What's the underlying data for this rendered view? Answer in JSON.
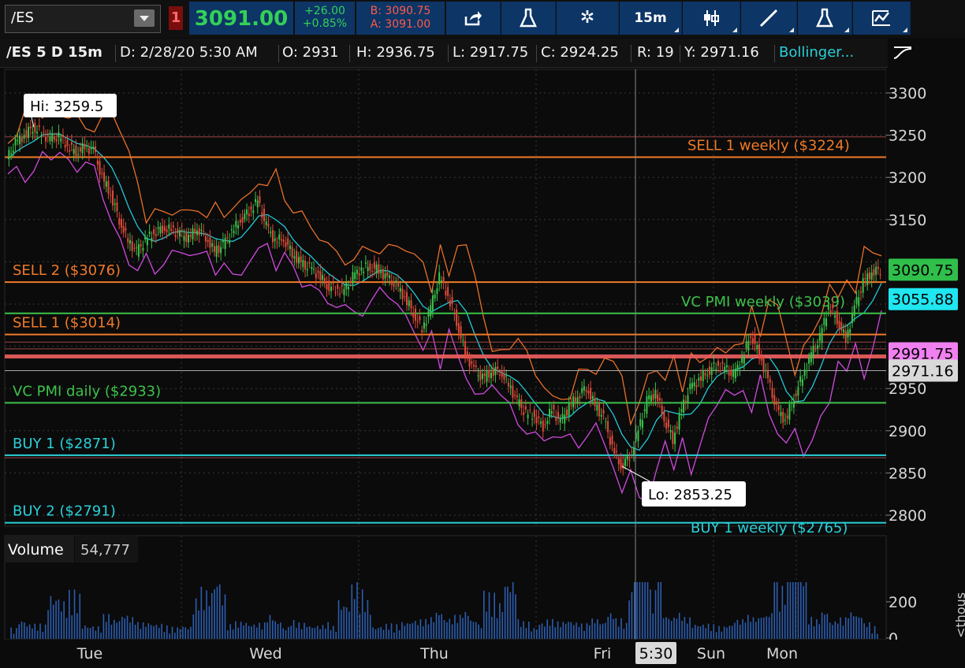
{
  "toolbar": {
    "symbol": "/ES",
    "link_number": "1",
    "last_price": "3091.00",
    "net_change": "+26.00",
    "percent_change": "+0.85%",
    "bid": "B: 3090.75",
    "ask": "A: 3091.00",
    "timeframe": "15m",
    "icons": [
      "share-icon",
      "flask-icon",
      "gear-icon",
      "candlestick-icon",
      "line-draw-icon",
      "flask-icon",
      "pattern-icon"
    ]
  },
  "info_bar": {
    "symbol_period": "/ES 5 D 15m",
    "date": "D: 2/28/20 5:30 AM",
    "open": "O: 2931",
    "high": "H: 2936.75",
    "low": "L: 2917.75",
    "close": "C: 2924.25",
    "range": "R: 19",
    "y": "Y: 2971.16",
    "study": "Bollinger..."
  },
  "chart_data": {
    "type": "line",
    "symbol": "/ES",
    "period": "5 D 15m",
    "x_labels": [
      "Tue",
      "Wed",
      "Thu",
      "Fri",
      "Sun",
      "Mon"
    ],
    "cursor_time_label": "5:30",
    "y_ticks": [
      3300,
      3250,
      3200,
      3150,
      2950,
      2900,
      2850,
      2800
    ],
    "ylim": [
      2790,
      3310
    ],
    "grid": true,
    "annotations": {
      "high": "Hi: 3259.5",
      "low": "Lo: 2853.25"
    },
    "levels": [
      {
        "label": "SELL 1 weekly ($3224)",
        "value": 3224,
        "color": "#f07a28"
      },
      {
        "label": "SELL 2  ($3076)",
        "value": 3076,
        "color": "#f07a28"
      },
      {
        "label": "VC PMI weekly ($3039)",
        "value": 3039,
        "color": "#3cc24a"
      },
      {
        "label": "SELL 1 ($3014)",
        "value": 3014,
        "color": "#f07a28"
      },
      {
        "label": "VC PMI daily ($2933)",
        "value": 2933,
        "color": "#3cc24a"
      },
      {
        "label": "BUY 1  ($2871)",
        "value": 2871,
        "color": "#2ad0d8"
      },
      {
        "label": "BUY 2  ($2791)",
        "value": 2791,
        "color": "#2ad0d8"
      },
      {
        "label": "BUY 1 weekly ($2765)",
        "value": 2765,
        "color": "#2ad0d8"
      }
    ],
    "price_badges": [
      {
        "label": "3090.75",
        "value": 3090.75,
        "bg": "#2fbf4a",
        "fg": "#000000"
      },
      {
        "label": "3055.88",
        "value": 3055.88,
        "bg": "#20e6f0",
        "fg": "#000000"
      },
      {
        "label": "2991.75",
        "value": 2991.75,
        "bg": "#f080f0",
        "fg": "#000000"
      },
      {
        "label": "2971.16",
        "value": 2971.16,
        "bg": "#d9d9d9",
        "fg": "#000000"
      }
    ],
    "price_series": [
      3222,
      3240,
      3250,
      3259.5,
      3252,
      3245,
      3248,
      3238,
      3230,
      3236,
      3232,
      3200,
      3180,
      3150,
      3125,
      3112,
      3125,
      3135,
      3140,
      3138,
      3132,
      3128,
      3140,
      3130,
      3112,
      3120,
      3135,
      3150,
      3160,
      3172,
      3142,
      3125,
      3128,
      3110,
      3098,
      3092,
      3085,
      3072,
      3068,
      3066,
      3082,
      3092,
      3095,
      3090,
      3080,
      3072,
      3058,
      3040,
      3020,
      3045,
      3082,
      3060,
      3030,
      2992,
      2972,
      2962,
      2970,
      2972,
      2955,
      2935,
      2920,
      2918,
      2905,
      2925,
      2910,
      2928,
      2942,
      2952,
      2930,
      2915,
      2880,
      2858,
      2870,
      2900,
      2935,
      2945,
      2915,
      2890,
      2925,
      2950,
      2960,
      2970,
      2978,
      2974,
      2965,
      2985,
      3015,
      2990,
      2960,
      2925,
      2912,
      2940,
      2965,
      2990,
      3010,
      3048,
      3032,
      3008,
      3045,
      3075,
      3088,
      3091
    ],
    "volume": {
      "label": "Volume",
      "value": "54,777",
      "y_ticks": [
        200,
        0
      ],
      "unit_label": "<thous"
    }
  }
}
